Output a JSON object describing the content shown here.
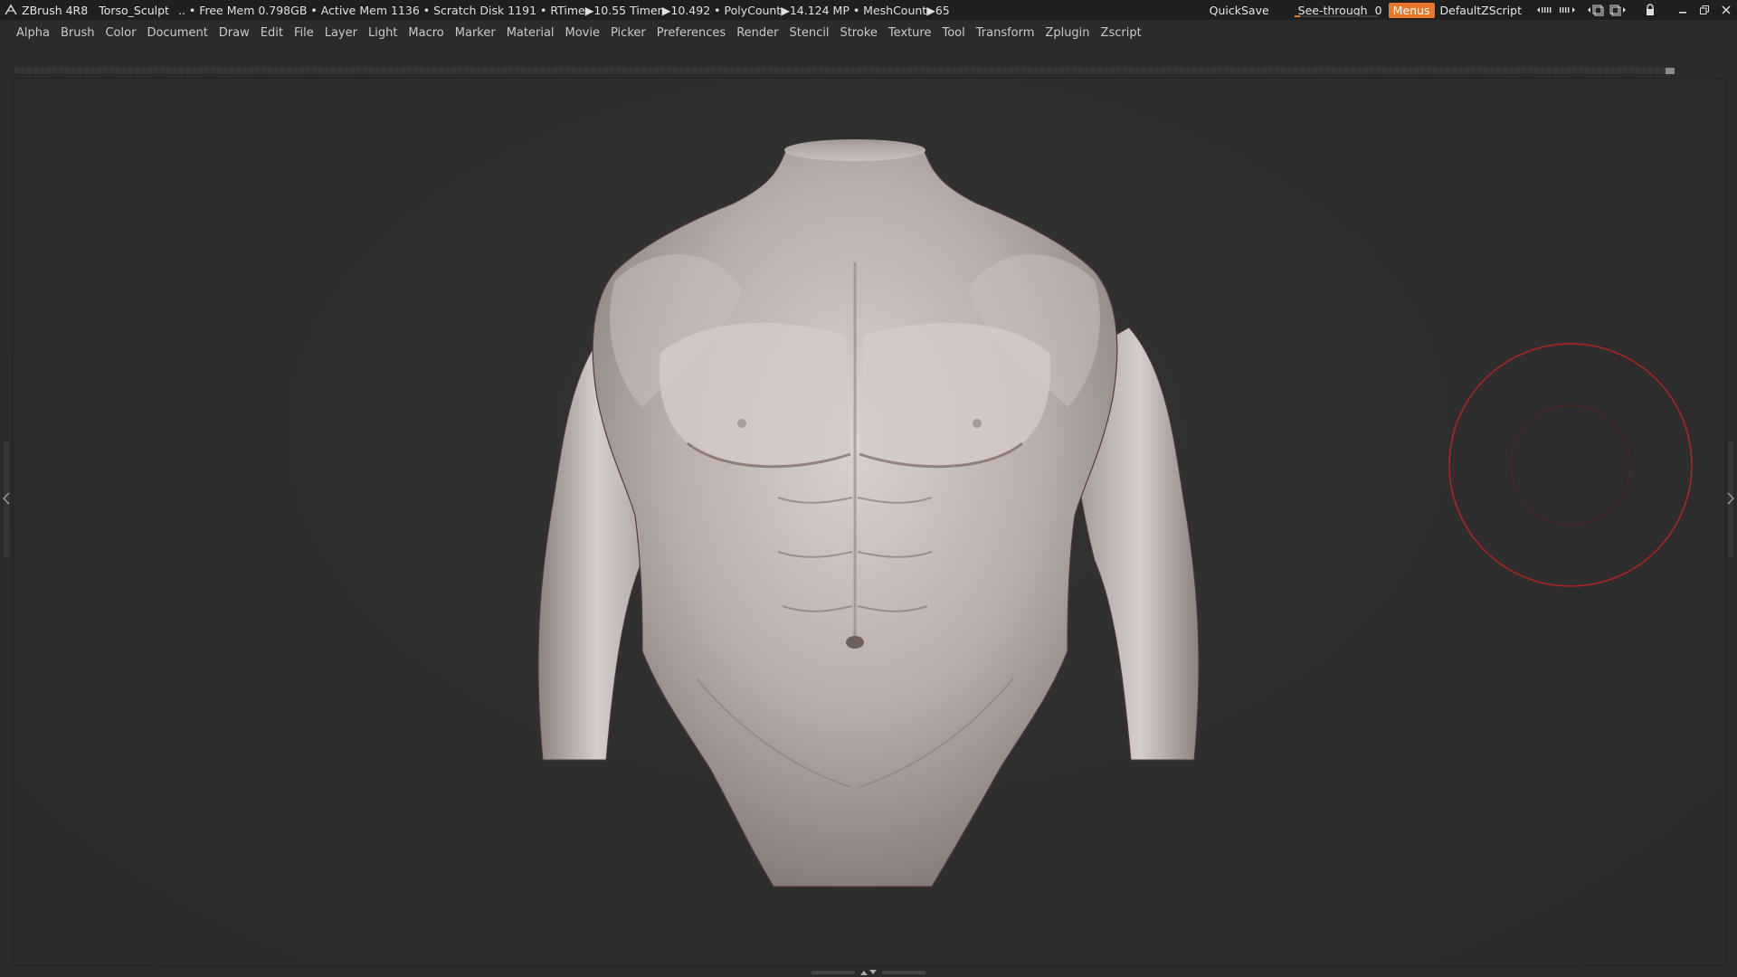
{
  "titlebar": {
    "app_name": "ZBrush 4R8",
    "document": "Torso_Sculpt",
    "status": ".. • Free Mem 0.798GB • Active Mem 1136 • Scratch Disk 1191 •  RTime▶10.55 Timer▶10.492 • PolyCount▶14.124 MP  • MeshCount▶65",
    "quicksave": "QuickSave",
    "see_through_label": "See-through",
    "see_through_value": "0",
    "see_through_level": 0.06,
    "menus_label": "Menus",
    "default_script": "DefaultZScript",
    "accent_color": "#e8772a"
  },
  "menubar": {
    "items": [
      "Alpha",
      "Brush",
      "Color",
      "Document",
      "Draw",
      "Edit",
      "File",
      "Layer",
      "Light",
      "Macro",
      "Marker",
      "Material",
      "Movie",
      "Picker",
      "Preferences",
      "Render",
      "Stencil",
      "Stroke",
      "Texture",
      "Tool",
      "Transform",
      "Zplugin",
      "Zscript"
    ]
  },
  "viewport": {
    "model": "male torso sculpt",
    "brush_cursor_color": "#b3231f"
  }
}
